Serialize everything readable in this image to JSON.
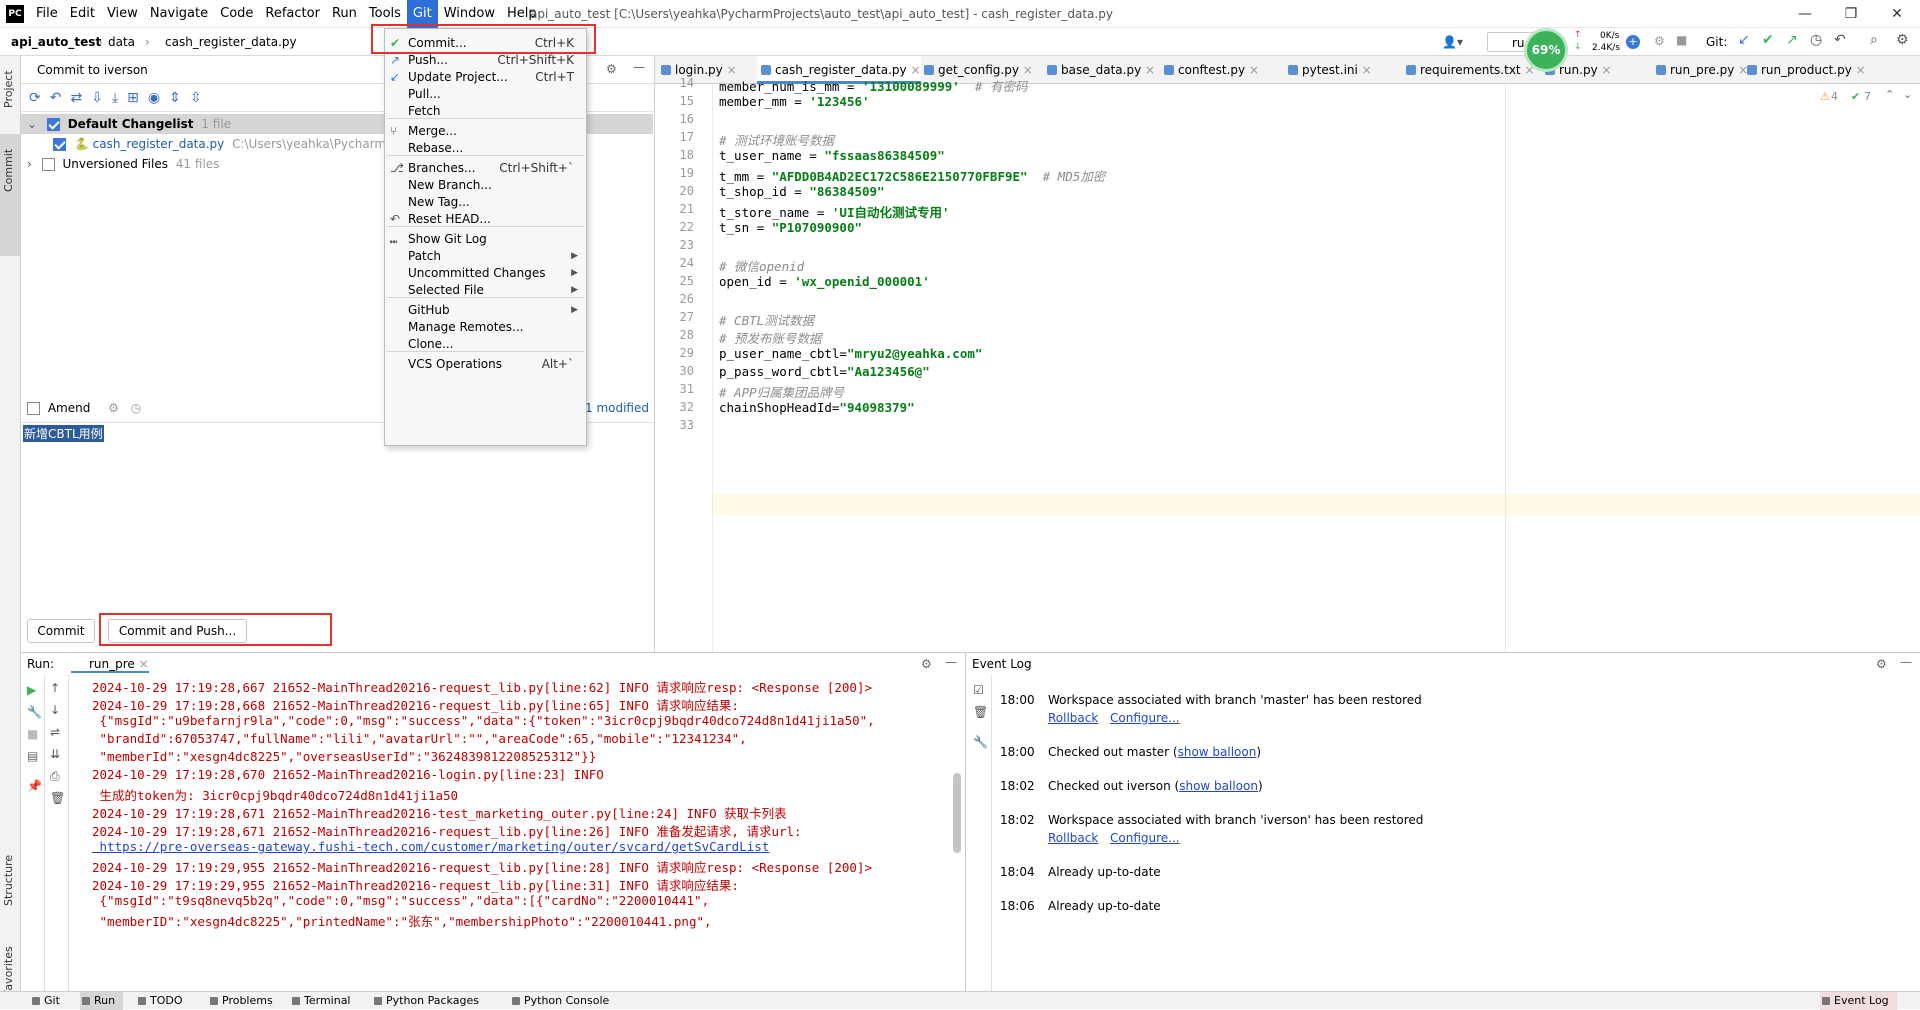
{
  "menubar": {
    "logo": "PC",
    "items": [
      "File",
      "Edit",
      "View",
      "Navigate",
      "Code",
      "Refactor",
      "Run",
      "Tools",
      "Git",
      "Window",
      "Help"
    ],
    "active": "Git"
  },
  "title": "api_auto_test [C:\\Users\\yeahka\\PycharmProjects\\auto_test\\api_auto_test] - cash_register_data.py",
  "window_controls": {
    "minimize": "—",
    "maximize": "❐",
    "close": "✕"
  },
  "navbar": {
    "project": "api_auto_test",
    "folder": "data",
    "file": "cash_register_data.py",
    "run_config": "ru",
    "git_label": "Git:"
  },
  "network_widget": {
    "percent": "69%",
    "up": "0K/s",
    "down": "2.4K/s"
  },
  "left_tool": {
    "project": "Project",
    "commit": "Commit",
    "structure": "Structure",
    "favorites": "Favorites"
  },
  "commit_panel": {
    "header": "Commit to iverson",
    "changelist": {
      "name": "Default Changelist",
      "count": "1 file"
    },
    "file": {
      "name": "cash_register_data.py",
      "path": "C:\\Users\\yeahka\\Pycharm"
    },
    "unversioned": {
      "name": "Unversioned Files",
      "count": "41 files"
    },
    "amend": "Amend",
    "modified": "1 modified",
    "message": "新增CBTL用例",
    "commit_btn": "Commit",
    "commit_push_btn": "Commit and Push..."
  },
  "git_menu": [
    {
      "label": "Commit...",
      "shortcut": "Ctrl+K",
      "icon": "check"
    },
    {
      "label": "Push...",
      "shortcut": "Ctrl+Shift+K",
      "icon": "push"
    },
    {
      "label": "Update Project...",
      "shortcut": "Ctrl+T",
      "icon": "update"
    },
    {
      "label": "Pull..."
    },
    {
      "label": "Fetch"
    },
    {
      "label": "Merge...",
      "icon": "merge"
    },
    {
      "label": "Rebase..."
    },
    {
      "label": "Branches...",
      "shortcut": "Ctrl+Shift+`",
      "icon": "branch"
    },
    {
      "label": "New Branch..."
    },
    {
      "label": "New Tag..."
    },
    {
      "label": "Reset HEAD...",
      "icon": "reset"
    },
    {
      "label": "Show Git Log",
      "icon": "log"
    },
    {
      "label": "Patch",
      "submenu": true
    },
    {
      "label": "Uncommitted Changes",
      "submenu": true
    },
    {
      "label": "Selected File",
      "submenu": true
    },
    {
      "label": "GitHub",
      "submenu": true
    },
    {
      "label": "Manage Remotes..."
    },
    {
      "label": "Clone..."
    },
    {
      "label": "VCS Operations",
      "shortcut": "Alt+`"
    }
  ],
  "editor": {
    "tabs": [
      "login.py",
      "cash_register_data.py",
      "get_config.py",
      "base_data.py",
      "conftest.py",
      "pytest.ini",
      "requirements.txt",
      "run.py",
      "run_pre.py",
      "run_product.py"
    ],
    "inspection": {
      "warnings": "4",
      "ok": "7"
    },
    "lines": [
      {
        "n": "14",
        "code": "member_num_is_mm = '13100089999'  # 有密码"
      },
      {
        "n": "15",
        "code": "member_mm = '123456'"
      },
      {
        "n": "16",
        "code": ""
      },
      {
        "n": "17",
        "code": "# 测试环境账号数据"
      },
      {
        "n": "18",
        "code": "t_user_name = \"fssaas86384509\""
      },
      {
        "n": "19",
        "code": "t_mm = \"AFDD0B4AD2EC172C586E2150770FBF9E\"  # MD5加密"
      },
      {
        "n": "20",
        "code": "t_shop_id = \"86384509\""
      },
      {
        "n": "21",
        "code": "t_store_name = 'UI自动化测试专用'"
      },
      {
        "n": "22",
        "code": "t_sn = \"P107090900\""
      },
      {
        "n": "23",
        "code": ""
      },
      {
        "n": "24",
        "code": "# 微信openid"
      },
      {
        "n": "25",
        "code": "open_id = 'wx_openid_000001'"
      },
      {
        "n": "26",
        "code": ""
      },
      {
        "n": "27",
        "code": "# CBTL测试数据"
      },
      {
        "n": "28",
        "code": "# 预发布账号数据"
      },
      {
        "n": "29",
        "code": "p_user_name_cbtl=\"mryu2@yeahka.com\""
      },
      {
        "n": "30",
        "code": "p_pass_word_cbtl=\"Aa123456@\""
      },
      {
        "n": "31",
        "code": "# APP归属集团品牌号"
      },
      {
        "n": "32",
        "code": "chainShopHeadId=\"94098379\""
      },
      {
        "n": "33",
        "code": ""
      }
    ]
  },
  "run_panel": {
    "label": "Run:",
    "tab": "run_pre",
    "log": [
      "2024-10-29 17:19:28,667 21652-MainThread20216-request_lib.py[line:62] INFO 请求响应resp: <Response [200]>",
      "2024-10-29 17:19:28,668 21652-MainThread20216-request_lib.py[line:65] INFO 请求响应结果:",
      " {\"msgId\":\"u9befarnjr9la\",\"code\":0,\"msg\":\"success\",\"data\":{\"token\":\"3icr0cpj9bqdr40dco724d8n1d41ji1a50\",",
      " \"brandId\":67053747,\"fullName\":\"lili\",\"avatarUrl\":\"\",\"areaCode\":65,\"mobile\":\"12341234\",",
      " \"memberId\":\"xesgn4dc8225\",\"overseasUserId\":\"3624839812208525312\"}}",
      "2024-10-29 17:19:28,670 21652-MainThread20216-login.py[line:23] INFO",
      " 生成的token为: 3icr0cpj9bqdr40dco724d8n1d41ji1a50",
      "2024-10-29 17:19:28,671 21652-MainThread20216-test_marketing_outer.py[line:24] INFO 获取卡列表",
      "2024-10-29 17:19:28,671 21652-MainThread20216-request_lib.py[line:26] INFO 准备发起请求, 请求url:",
      " https://pre-overseas-gateway.fushi-tech.com/customer/marketing/outer/svcard/getSvCardList",
      "2024-10-29 17:19:29,955 21652-MainThread20216-request_lib.py[line:28] INFO 请求响应resp: <Response [200]>",
      "2024-10-29 17:19:29,955 21652-MainThread20216-request_lib.py[line:31] INFO 请求响应结果:",
      " {\"msgId\":\"t9sq8nevq5b2q\",\"code\":0,\"msg\":\"success\",\"data\":[{\"cardNo\":\"2200010441\",",
      " \"memberID\":\"xesgn4dc8225\",\"printedName\":\"张东\",\"membershipPhoto\":\"2200010441.png\","
    ]
  },
  "event_log": {
    "title": "Event Log",
    "events": [
      {
        "time": "18:00",
        "msg": "Workspace associated with branch 'master' has been restored",
        "links": [
          "Rollback",
          "Configure..."
        ]
      },
      {
        "time": "18:00",
        "msg": "Checked out master (",
        "link": "show balloon",
        "tail": ")"
      },
      {
        "time": "18:02",
        "msg": "Checked out iverson (",
        "link": "show balloon",
        "tail": ")"
      },
      {
        "time": "18:02",
        "msg": "Workspace associated with branch 'iverson' has been restored",
        "links": [
          "Rollback",
          "Configure..."
        ]
      },
      {
        "time": "18:04",
        "msg": "Already up-to-date"
      },
      {
        "time": "18:06",
        "msg": "Already up-to-date"
      }
    ]
  },
  "statusbar": [
    "Git",
    "Run",
    "TODO",
    "Problems",
    "Terminal",
    "Python Packages",
    "Python Console"
  ],
  "statusbar_right": "Event Log",
  "colors": {
    "accent": "#2d6fd6",
    "highlight_box": "#e53030",
    "log_red": "#c00000"
  }
}
